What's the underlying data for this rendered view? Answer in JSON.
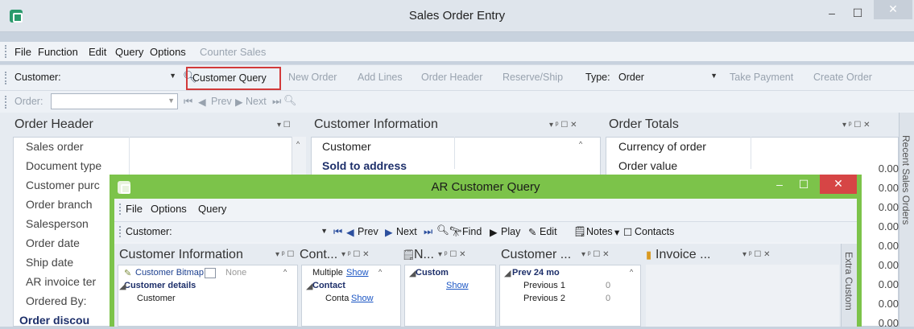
{
  "window": {
    "title": "Sales Order Entry",
    "minimize": "–",
    "maximize": "☐",
    "close": "✕"
  },
  "menu": [
    "File",
    "Function",
    "Edit",
    "Query",
    "Options",
    "Counter Sales"
  ],
  "toolbar1": {
    "customer_label": "Customer:",
    "customer_query": "Customer Query",
    "new_order": "New Order",
    "add_lines": "Add Lines",
    "order_header": "Order Header",
    "reserve_ship": "Reserve/Ship",
    "type_label": "Type:",
    "type_value": "Order",
    "take_payment": "Take Payment",
    "create_order": "Create Order"
  },
  "toolbar2": {
    "order_label": "Order:",
    "prev": "Prev",
    "next": "Next"
  },
  "order_header": {
    "title": "Order Header",
    "rows": [
      "Sales order",
      "Document type",
      "Customer purc",
      "Order branch",
      "Salesperson",
      "Order date",
      "Ship date",
      "AR invoice ter",
      "Ordered By:",
      "Order discou"
    ]
  },
  "customer_info": {
    "title": "Customer Information",
    "rows": [
      "Customer",
      "Sold to address"
    ]
  },
  "order_totals": {
    "title": "Order Totals",
    "rows": [
      "Currency of order",
      "Order value"
    ],
    "values": [
      "0.00",
      "0.00",
      "0.00",
      "0.00",
      "0.00",
      "0.00",
      "0.00",
      "0.00",
      "0.00"
    ]
  },
  "side_tab": "Recent Sales Orders",
  "ar": {
    "title": "AR Customer Query",
    "menu": [
      "File",
      "Options",
      "Query"
    ],
    "customer_label": "Customer:",
    "prev": "Prev",
    "next": "Next",
    "find": "Find",
    "play": "Play",
    "edit": "Edit",
    "notes": "Notes",
    "contacts": "Contacts",
    "panels": {
      "ci_title": "Customer Information",
      "cont_title": "Cont...",
      "n_title": "N...",
      "cust_title": "Customer ...",
      "inv_title": "Invoice ..."
    },
    "ci": {
      "bitmap": "Customer Bitmap",
      "none": "None",
      "details": "Customer details",
      "customer": "Customer"
    },
    "cont": {
      "multiple": "Multiple",
      "show": "Show",
      "contact": "Contact",
      "conta": "Conta",
      "show2": "Show"
    },
    "n": {
      "custom": "Custom",
      "show": "Show"
    },
    "cust": {
      "prev24": "Prev 24 mo",
      "p1": "Previous 1",
      "p2": "Previous 2",
      "v1": "0",
      "v2": "0"
    },
    "side_tab": "Extra Custom"
  }
}
